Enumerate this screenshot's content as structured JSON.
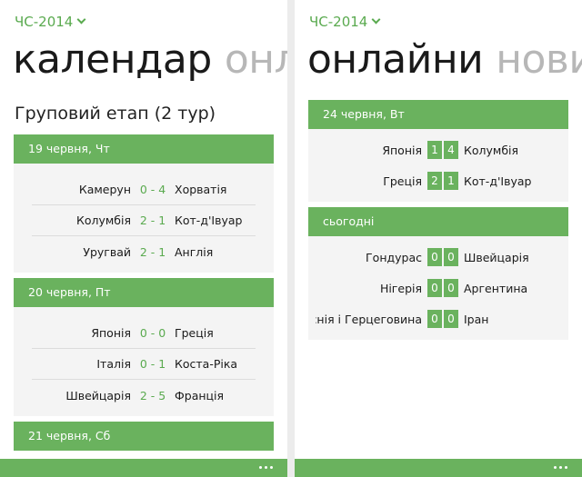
{
  "left": {
    "app_title": "ЧС-2014",
    "pivot_active": "календар",
    "pivot_next": "онлайни",
    "section_title": "Груповий етап (2 тур)",
    "days": [
      {
        "date": "19 червня, Чт",
        "matches": [
          {
            "home": "Камерун",
            "score": "0 - 4",
            "away": "Хорватія"
          },
          {
            "home": "Колумбія",
            "score": "2 - 1",
            "away": "Кот-д'Івуар"
          },
          {
            "home": "Уругвай",
            "score": "2 - 1",
            "away": "Англія"
          }
        ]
      },
      {
        "date": "20 червня, Пт",
        "matches": [
          {
            "home": "Японія",
            "score": "0 - 0",
            "away": "Греція"
          },
          {
            "home": "Італія",
            "score": "0 - 1",
            "away": "Коста-Ріка"
          },
          {
            "home": "Швейцарія",
            "score": "2 - 5",
            "away": "Франція"
          }
        ]
      },
      {
        "date": "21 червня, Сб"
      }
    ]
  },
  "right": {
    "app_title": "ЧС-2014",
    "pivot_active": "онлайни",
    "pivot_next": "новини",
    "days": [
      {
        "date": "24 червня, Вт",
        "matches": [
          {
            "home": "Японія",
            "home_score": "1",
            "away_score": "4",
            "away": "Колумбія"
          },
          {
            "home": "Греція",
            "home_score": "2",
            "away_score": "1",
            "away": "Кот-д'Івуар"
          }
        ]
      },
      {
        "date": "сьогодні",
        "matches": [
          {
            "home": "Гондурас",
            "home_score": "0",
            "away_score": "0",
            "away": "Швейцарія"
          },
          {
            "home": "Нігерія",
            "home_score": "0",
            "away_score": "0",
            "away": "Аргентина"
          },
          {
            "home": "Боснія і Герцеговина",
            "home_score": "0",
            "away_score": "0",
            "away": "Іран"
          }
        ]
      }
    ]
  },
  "colors": {
    "accent": "#6ab25e",
    "accent_text": "#5aaa4f",
    "inactive_pivot": "#b7b7b7"
  },
  "icons": {
    "more": "ellipsis-icon",
    "dropdown": "chevron-down-icon"
  }
}
